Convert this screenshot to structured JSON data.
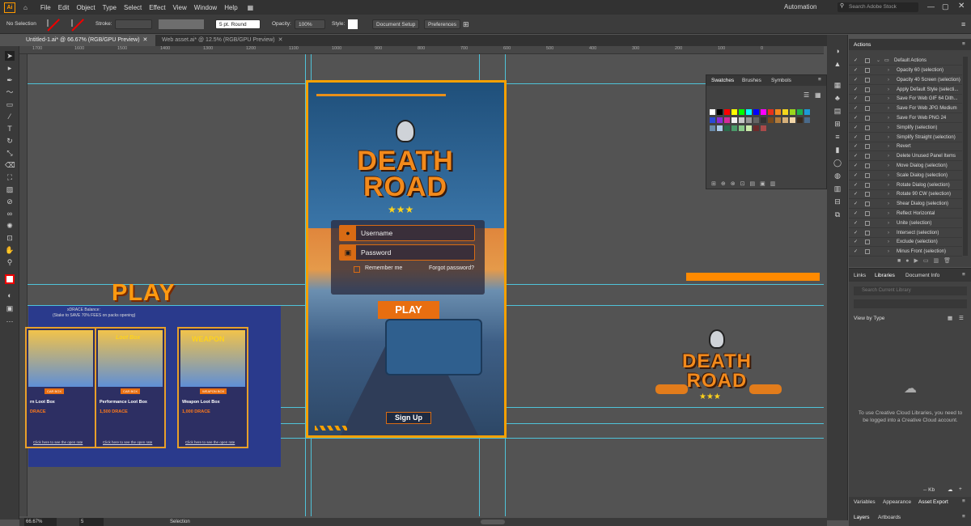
{
  "app": {
    "logo_text": "Ai"
  },
  "menu": [
    "File",
    "Edit",
    "Object",
    "Type",
    "Select",
    "Effect",
    "View",
    "Window",
    "Help"
  ],
  "header_right": {
    "workspace": "Automation",
    "search_placeholder": "Search Adobe Stock"
  },
  "control_bar": {
    "selection": "No Selection",
    "stroke_label": "Stroke:",
    "brush": "5 pt. Round",
    "opacity_label": "Opacity:",
    "opacity_value": "100%",
    "style_label": "Style:",
    "doc_setup": "Document Setup",
    "preferences": "Preferences"
  },
  "tabs": [
    {
      "label": "Untitled-1.ai* @ 66.67% (RGB/GPU Preview)",
      "active": true
    },
    {
      "label": "Web asset.ai* @ 12.5% (RGB/GPU Preview)",
      "active": false
    }
  ],
  "ruler": [
    "1700",
    "1600",
    "1500",
    "1400",
    "1300",
    "1200",
    "1100",
    "1000",
    "900",
    "800",
    "700",
    "600",
    "500",
    "400",
    "300",
    "200",
    "100",
    "0"
  ],
  "artboard": {
    "logo_line1": "DEATH",
    "logo_line2": "ROAD",
    "username": "Username",
    "password": "Password",
    "remember": "Remember me",
    "forgot": "Forgot password?",
    "play": "PLAY",
    "signup": "Sign Up"
  },
  "right_logo": {
    "line1": "DEATH",
    "line2": "ROAD"
  },
  "loot": {
    "title": "PLAY",
    "balance_line1": "xDRACE Balance:",
    "balance_line2": "(Stake to SAVE 70% FEES on packs opening)",
    "cards": [
      {
        "name": "rn Loot Box",
        "price": "DRACE",
        "badge": "CAR BOX",
        "banner": "Loot Box"
      },
      {
        "name": "Performance Loot Box",
        "price": "1,500 DRACE",
        "badge": "CAR BOX",
        "banner": "Loot Box"
      },
      {
        "name": "Weapon Loot Box",
        "price": "1,000 DRACE",
        "badge": "WEAPON BOX",
        "banner": "WEAPON"
      }
    ],
    "link": "Click here to see the open rate"
  },
  "actions_panel": {
    "tab": "Actions",
    "folder": "Default Actions",
    "items": [
      "Opacity 60 (selection)",
      "Opacity 40 Screen (selection)",
      "Apply Default Style (selecti...",
      "Save For Web GIF 64 Dith...",
      "Save For Web JPG Medium",
      "Save For Web PNG 24",
      "Simplify (selection)",
      "Simplify Straight (selection)",
      "Revert",
      "Delete Unused Panel Items",
      "Move Dialog (selection)",
      "Scale Dialog (selection)",
      "Rotate Dialog (selection)",
      "Rotate 90 CW (selection)",
      "Shear Dialog (selection)",
      "Reflect Horizontal",
      "Unite (selection)",
      "Intersect (selection)",
      "Exclude (selection)",
      "Minus Front (selection)"
    ]
  },
  "swatches_panel": {
    "tabs": [
      "Swatches",
      "Brushes",
      "Symbols"
    ]
  },
  "libraries_panel": {
    "tabs": [
      "Links",
      "Libraries",
      "Document Info"
    ],
    "search_placeholder": "Search Current Library",
    "view_by": "View by Type",
    "message": "To use Creative Cloud Libraries, you need to be logged into a Creative Cloud account.",
    "size": "-- Kb"
  },
  "bottom_panels": {
    "row1": [
      "Variables",
      "Appearance",
      "Asset Export"
    ],
    "row2": [
      "Layers",
      "Artboards"
    ]
  },
  "status": {
    "zoom": "66.67%",
    "page": "5",
    "tool": "Selection"
  },
  "colors": {
    "accent": "#f5a000",
    "guide": "#4fc3d9",
    "ui_bg": "#535353"
  }
}
